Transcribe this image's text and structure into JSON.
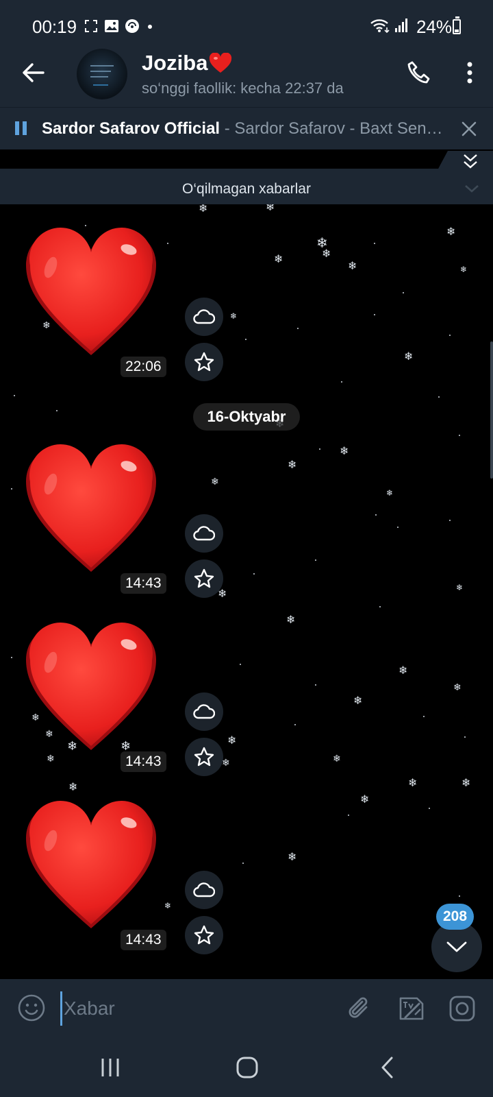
{
  "status_bar": {
    "time": "00:19",
    "battery": "24%",
    "icons": [
      "screenshot-icon",
      "gallery-icon",
      "vpn-icon",
      "dot-icon",
      "wifi-icon",
      "signal-icon",
      "battery-icon"
    ]
  },
  "header": {
    "title": "Joziba",
    "title_emoji": "❤️",
    "subtitle": "so‘nggi faollik: kecha 22:37 da"
  },
  "music": {
    "artist": "Sardor Safarov Official",
    "separator": " - ",
    "title": "Sardor Safarov - Baxt Sen…"
  },
  "unread_divider": "O‘qilmagan xabarlar",
  "messages": [
    {
      "type": "sticker",
      "emoji": "heart",
      "time": "22:06"
    },
    {
      "type": "sticker",
      "emoji": "heart",
      "time": "14:43"
    },
    {
      "type": "sticker",
      "emoji": "heart",
      "time": "14:43"
    },
    {
      "type": "sticker",
      "emoji": "heart",
      "time": "14:43"
    }
  ],
  "date_separator": "16-Oktyabr",
  "unread_count": "208",
  "input": {
    "placeholder": "Xabar"
  },
  "colors": {
    "bar_bg": "#1d2733",
    "accent": "#3c94d6",
    "heart": "#e8201e",
    "muted_text": "#8d9aa7"
  }
}
